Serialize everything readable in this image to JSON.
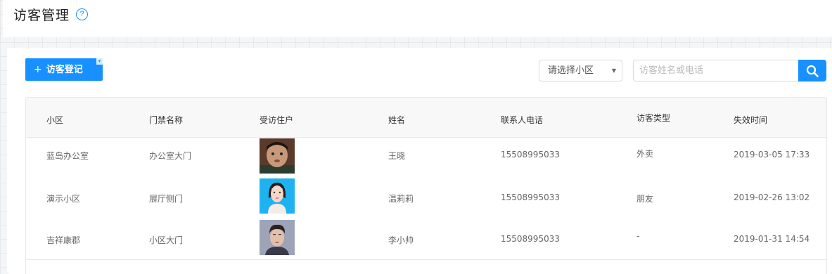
{
  "header": {
    "title": "访客管理",
    "help_icon": "?"
  },
  "toolbar": {
    "add_icon": "+",
    "add_label": "访客登记",
    "community_select": {
      "value": "请选择小区",
      "arrow": "▼"
    },
    "search": {
      "placeholder": "访客姓名或电话"
    }
  },
  "table": {
    "columns": [
      "小区",
      "门禁名称",
      "受访住户",
      "姓名",
      "联系人电话",
      "访客类型",
      "失效时间"
    ],
    "rows": [
      {
        "community": "蓝岛办公室",
        "gate": "办公室大门",
        "host": "boy-avatar",
        "name": "王晓",
        "phone": "15508995033",
        "type": "外卖",
        "expires": "2019-03-05 17:33"
      },
      {
        "community": "演示小区",
        "gate": "展厅侧门",
        "host": "woman-avatar",
        "name": "温莉莉",
        "phone": "15508995033",
        "type": "朋友",
        "expires": "2019-02-26 13:02"
      },
      {
        "community": "吉祥康郡",
        "gate": "小区大门",
        "host": "man-avatar",
        "name": "李小帅",
        "phone": "15508995033",
        "type": "-",
        "expires": "2019-01-31 14:54"
      }
    ]
  },
  "colors": {
    "primary": "#1890ff"
  }
}
